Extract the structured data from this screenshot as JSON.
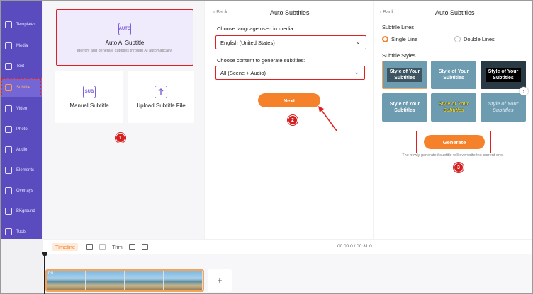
{
  "sidebar": {
    "items": [
      {
        "label": "Templates"
      },
      {
        "label": "Media"
      },
      {
        "label": "Text"
      },
      {
        "label": "Subtitle"
      },
      {
        "label": "Video"
      },
      {
        "label": "Photo"
      },
      {
        "label": "Audio"
      },
      {
        "label": "Elements"
      },
      {
        "label": "Overlays"
      },
      {
        "label": "BKground"
      },
      {
        "label": "Tools"
      }
    ],
    "active_index": 3
  },
  "panel_options": {
    "auto_ai": {
      "icon_text": "AUTO",
      "title": "Auto AI Subtitle",
      "subtitle": "Identify and generate subtitles through AI automatically."
    },
    "manual": {
      "icon_text": "SUB",
      "title": "Manual Subtitle"
    },
    "upload": {
      "title": "Upload Subtitle File"
    }
  },
  "panel_lang": {
    "back": "Back",
    "title": "Auto Subtitles",
    "lang_label": "Choose language used in media:",
    "lang_value": "English (United States)",
    "content_label": "Choose content to generate subtitles:",
    "content_value": "All (Scene + Audio)",
    "next_label": "Next"
  },
  "panel_styles": {
    "back": "Back",
    "title": "Auto Subtitles",
    "lines_label": "Subtitle Lines",
    "single_line": "Single Line",
    "double_lines": "Double Lines",
    "styles_label": "Subtitle Styles",
    "style_text_1": "Style of Your",
    "style_text_2": "Subtitles",
    "generate_label": "Generate",
    "note": "The newly generated subtitle will overwrite the current one."
  },
  "badges": {
    "one": "1",
    "two": "2",
    "three": "3"
  },
  "timeline": {
    "tab": "Timeline",
    "trim": "Trim",
    "time": "00:00.0 / 00:31.0",
    "clip_label": "0:0",
    "add": "+"
  },
  "colors": {
    "sidebar": "#5a4bbf",
    "accent": "#f5822a",
    "highlight": "#e02020"
  }
}
